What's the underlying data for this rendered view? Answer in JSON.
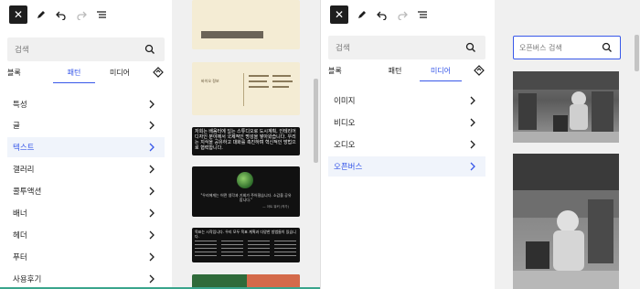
{
  "left": {
    "search_placeholder": "검색",
    "tabs": [
      "블록",
      "패턴",
      "미디어"
    ],
    "items": [
      "특성",
      "글",
      "텍스트",
      "갤러리",
      "콜투액션",
      "배너",
      "헤더",
      "푸터",
      "사용후기"
    ],
    "active_item": "텍스트",
    "thumbs": [
      {
        "text": ""
      },
      {
        "text": "바이오 정보"
      },
      {
        "text": "저희는 배움터에 있는 스튜디오로 도시계획, 인테리어 디자인 분야에서 국제적인 명성을 쌓아왔습니다. 우리는 지식을 공유하고 대화를 촉진하며 혁신적인 방법으로 협력합니다."
      },
      {
        "text": "\"우리에게는 어떤 생각과 기회가 주어졌습니다. 소감을 공유합니다.\"",
        "author": "— 아트 워커 (작가)"
      },
      {
        "text": "목표는 시작입니다. 우리 모두 목표 계획과 다양한 방법들이 있습니다."
      },
      {
        "text": ""
      }
    ]
  },
  "right": {
    "search_placeholder": "검색",
    "tabs": [
      "블록",
      "패턴",
      "미디어"
    ],
    "items": [
      "이미지",
      "비디오",
      "오디오",
      "오픈버스"
    ],
    "active_item": "오픈버스",
    "openverse_search_placeholder": "오픈버스 검색"
  },
  "colors": {
    "accent": "#3858e9",
    "dark": "#1e1e1e"
  }
}
